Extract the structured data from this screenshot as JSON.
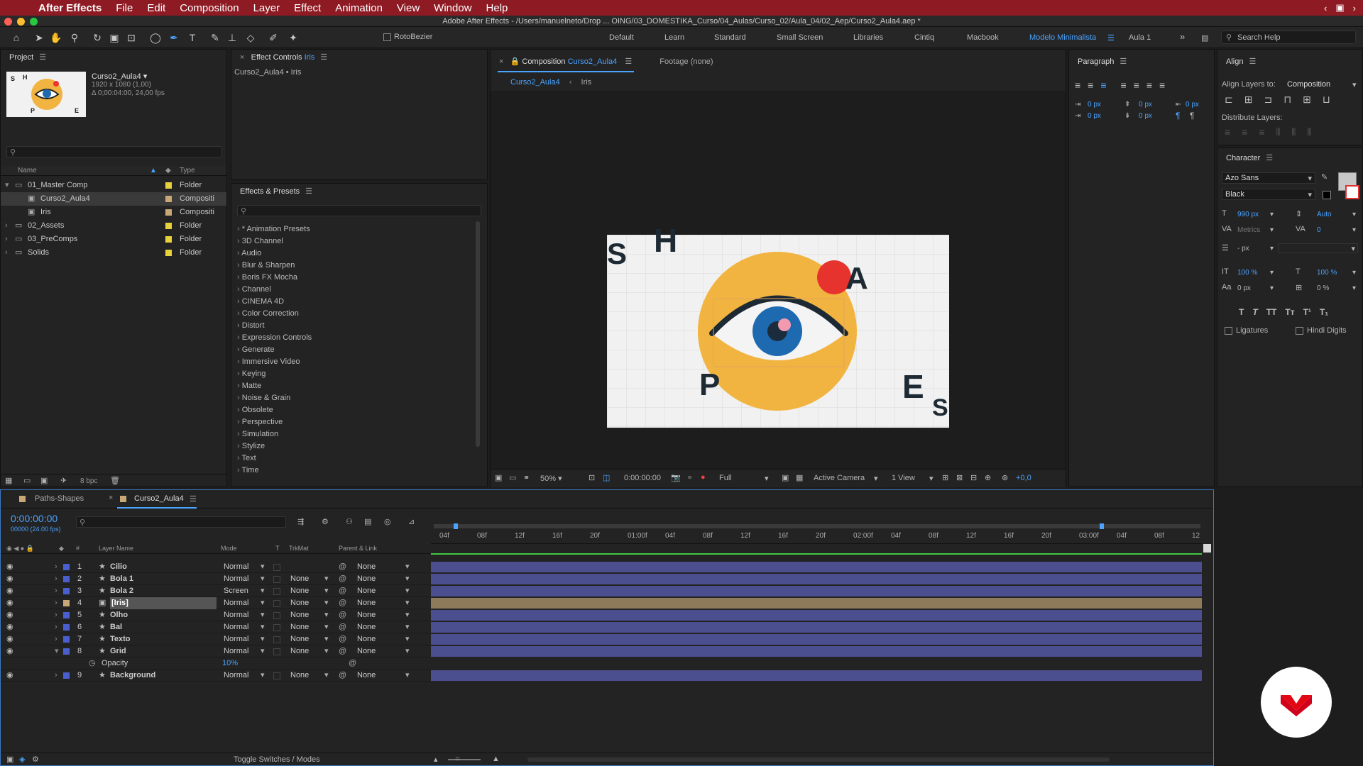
{
  "menubar": {
    "app": "After Effects",
    "items": [
      "File",
      "Edit",
      "Composition",
      "Layer",
      "Effect",
      "Animation",
      "View",
      "Window",
      "Help"
    ]
  },
  "window_title": "Adobe After Effects - /Users/manuelneto/Drop ... OING/03_DOMESTIKA_Curso/04_Aulas/Curso_02/Aula_04/02_Aep/Curso2_Aula4.aep *",
  "toolbar": {
    "rotobezier": "RotoBezier",
    "workspaces": [
      "Default",
      "Learn",
      "Standard",
      "Small Screen",
      "Libraries",
      "Cintiq",
      "Macbook",
      "Modelo Minimalista",
      "Aula 1"
    ],
    "active_workspace": "Modelo Minimalista",
    "search_help": "Search Help"
  },
  "project": {
    "title": "Project",
    "comp_name": "Curso2_Aula4",
    "comp_res": "1920 x 1080 (1,00)",
    "comp_dur": "Δ 0;00:04:00, 24,00 fps",
    "col_name": "Name",
    "col_type": "Type",
    "items": [
      {
        "name": "01_Master Comp",
        "type": "Folder",
        "color": "#e6d23a"
      },
      {
        "name": "Curso2_Aula4",
        "type": "Compositi",
        "color": "#c9a878"
      },
      {
        "name": "Iris",
        "type": "Compositi",
        "color": "#c9a878"
      },
      {
        "name": "02_Assets",
        "type": "Folder",
        "color": "#e6d23a"
      },
      {
        "name": "03_PreComps",
        "type": "Folder",
        "color": "#e6d23a"
      },
      {
        "name": "Solids",
        "type": "Folder",
        "color": "#e6d23a"
      }
    ],
    "bpc": "8 bpc"
  },
  "effect_controls": {
    "title": "Effect Controls",
    "target": "Iris",
    "subtitle": "Curso2_Aula4 • Iris"
  },
  "effects_presets": {
    "title": "Effects & Presets",
    "items": [
      "* Animation Presets",
      "3D Channel",
      "Audio",
      "Blur & Sharpen",
      "Boris FX Mocha",
      "Channel",
      "CINEMA 4D",
      "Color Correction",
      "Distort",
      "Expression Controls",
      "Generate",
      "Immersive Video",
      "Keying",
      "Matte",
      "Noise & Grain",
      "Obsolete",
      "Perspective",
      "Simulation",
      "Stylize",
      "Text",
      "Time"
    ]
  },
  "composition": {
    "label": "Composition",
    "name": "Curso2_Aula4",
    "footage": "Footage (none)",
    "tab1": "Curso2_Aula4",
    "tab2": "Iris",
    "zoom": "50%",
    "time": "0:00:00:00",
    "quality": "Full",
    "camera": "Active Camera",
    "views": "1 View",
    "exposure": "+0,0",
    "letters": {
      "s1": "S",
      "h": "H",
      "a": "A",
      "p": "P",
      "e": "E",
      "s2": "S"
    }
  },
  "paragraph": {
    "title": "Paragraph",
    "values": [
      "0 px",
      "0 px",
      "0 px",
      "0 px",
      "0 px"
    ]
  },
  "align": {
    "title": "Align",
    "align_to_label": "Align Layers to:",
    "align_to": "Composition",
    "distribute": "Distribute Layers:"
  },
  "character": {
    "title": "Character",
    "font": "Azo Sans",
    "style": "Black",
    "size": "990 px",
    "leading": "Auto",
    "kerning": "Metrics",
    "tracking": "0",
    "stroke": "- px",
    "vscale": "100 %",
    "hscale": "100 %",
    "baseline": "0 px",
    "tsume": "0 %",
    "ligatures": "Ligatures",
    "hindi": "Hindi Digits"
  },
  "timeline": {
    "tab1": "Paths-Shapes",
    "tab2": "Curso2_Aula4",
    "time": "0:00:00:00",
    "frames": "00000 (24.00 fps)",
    "col_layer": "Layer Name",
    "col_mode": "Mode",
    "col_t": "T",
    "col_trkmat": "TrkMat",
    "col_parent": "Parent & Link",
    "ruler": [
      "04f",
      "08f",
      "12f",
      "16f",
      "20f",
      "01:00f",
      "04f",
      "08f",
      "12f",
      "16f",
      "20f",
      "02:00f",
      "04f",
      "08f",
      "12f",
      "16f",
      "20f",
      "03:00f",
      "04f",
      "08f",
      "12"
    ],
    "layers": [
      {
        "num": "1",
        "name": "Cilio",
        "mode": "Normal",
        "trk": "",
        "parent": "None",
        "color": "#4a5fcf"
      },
      {
        "num": "2",
        "name": "Bola 1",
        "mode": "Normal",
        "trk": "None",
        "parent": "None",
        "color": "#4a5fcf"
      },
      {
        "num": "3",
        "name": "Bola 2",
        "mode": "Screen",
        "trk": "None",
        "parent": "None",
        "color": "#4a5fcf"
      },
      {
        "num": "4",
        "name": "[Iris]",
        "mode": "Normal",
        "trk": "None",
        "parent": "None",
        "color": "#c9a878"
      },
      {
        "num": "5",
        "name": "Olho",
        "mode": "Normal",
        "trk": "None",
        "parent": "None",
        "color": "#4a5fcf"
      },
      {
        "num": "6",
        "name": "Bal",
        "mode": "Normal",
        "trk": "None",
        "parent": "None",
        "color": "#4a5fcf"
      },
      {
        "num": "7",
        "name": "Texto",
        "mode": "Normal",
        "trk": "None",
        "parent": "None",
        "color": "#4a5fcf"
      },
      {
        "num": "8",
        "name": "Grid",
        "mode": "Normal",
        "trk": "None",
        "parent": "None",
        "color": "#4a5fcf"
      },
      {
        "num": "9",
        "name": "Background",
        "mode": "Normal",
        "trk": "None",
        "parent": "None",
        "color": "#4a5fcf"
      }
    ],
    "opacity_label": "Opacity",
    "opacity_value": "10%",
    "toggle": "Toggle Switches / Modes"
  }
}
